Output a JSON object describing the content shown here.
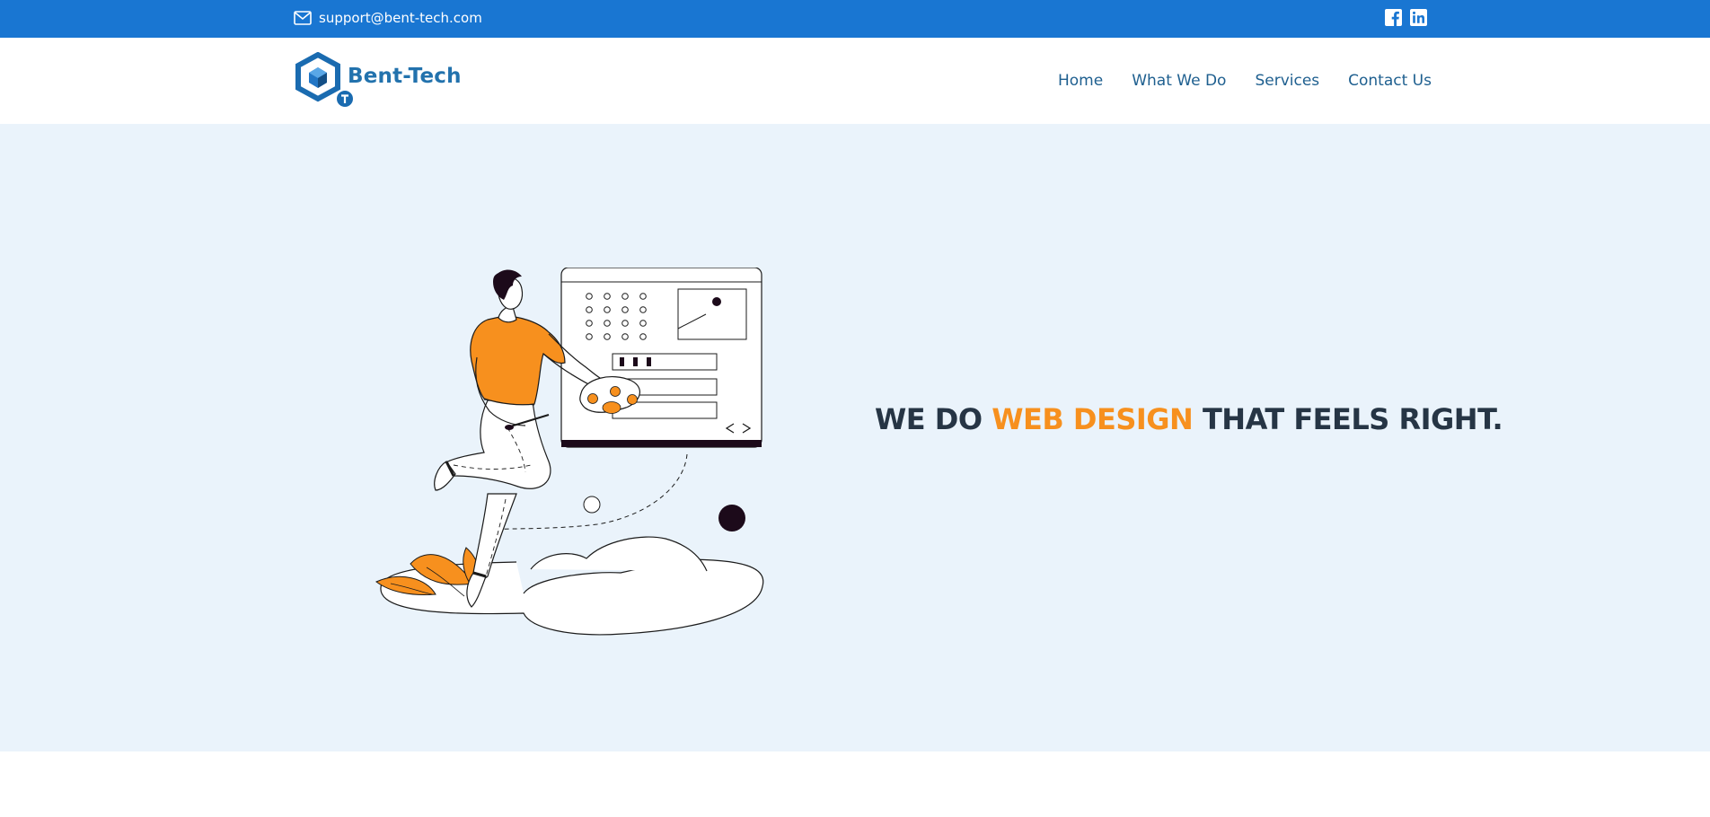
{
  "topbar": {
    "email": "support@bent-tech.com",
    "icons": {
      "email": "envelope-icon",
      "facebook": "facebook-icon",
      "linkedin": "linkedin-icon"
    }
  },
  "header": {
    "brand": "Bent-Tech",
    "nav": [
      "Home",
      "What We Do",
      "Services",
      "Contact Us"
    ]
  },
  "hero": {
    "headline_part1": "WE DO ",
    "headline_accent": "WEB DESIGN",
    "headline_part2": " THAT FEELS RIGHT.",
    "illustration": "designer-illustration"
  },
  "colors": {
    "topbar": "#1976d2",
    "hero_bg": "#eaf3fb",
    "accent": "#f7901e",
    "heading": "#263545",
    "nav": "#1e5f8f",
    "brand": "#2272ad"
  }
}
